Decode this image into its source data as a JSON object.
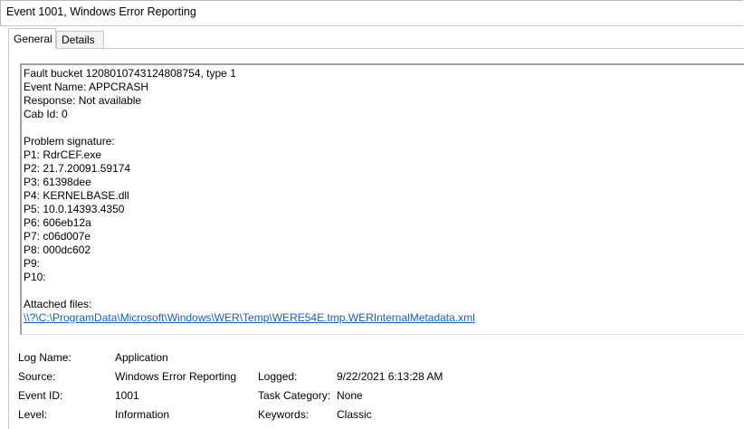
{
  "window": {
    "title": "Event 1001, Windows Error Reporting"
  },
  "tabs": [
    {
      "label": "General",
      "active": true
    },
    {
      "label": "Details",
      "active": false
    }
  ],
  "description": {
    "lines": [
      "Fault bucket 1208010743124808754, type 1",
      "Event Name: APPCRASH",
      "Response: Not available",
      "Cab Id: 0",
      "",
      "Problem signature:",
      "P1: RdrCEF.exe",
      "P2: 21.7.20091.59174",
      "P3: 61398dee",
      "P4: KERNELBASE.dll",
      "P5: 10.0.14393.4350",
      "P6: 606eb12a",
      "P7: c06d007e",
      "P8: 000dc602",
      "P9: ",
      "P10: ",
      "",
      "Attached files:"
    ],
    "attached_link": "\\\\?\\C:\\ProgramData\\Microsoft\\Windows\\WER\\Temp\\WERE54E.tmp.WERInternalMetadata.xml"
  },
  "properties": {
    "log_name_label": "Log Name:",
    "log_name": "Application",
    "source_label": "Source:",
    "source": "Windows Error Reporting",
    "logged_label": "Logged:",
    "logged": "9/22/2021 6:13:28 AM",
    "event_id_label": "Event ID:",
    "event_id": "1001",
    "task_category_label": "Task Category:",
    "task_category": "None",
    "level_label": "Level:",
    "level": "Information",
    "keywords_label": "Keywords:",
    "keywords": "Classic"
  },
  "colors": {
    "link": "#1a5bb5",
    "border": "#a0a0a0"
  }
}
